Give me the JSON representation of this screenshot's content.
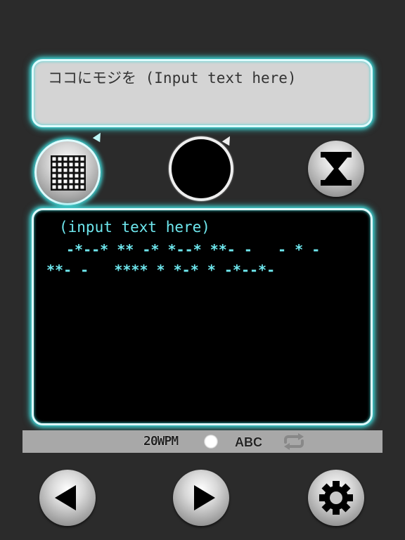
{
  "input": {
    "placeholder": "ココにモジを (Input text here)"
  },
  "output": {
    "plain_text": "(input text here)",
    "morse_line1": "-*--* ** -* *--* **- -   - * -",
    "morse_line2": "**- -   **** * *-* * -*--*-"
  },
  "status": {
    "wpm": "20WPM",
    "mode": "ABC"
  },
  "icons": {
    "grid": "grid-icon",
    "record": "record-icon",
    "timer": "hourglass-icon",
    "repeat": "repeat-icon",
    "prev": "play-backward-icon",
    "play": "play-icon",
    "settings": "gear-icon"
  },
  "colors": {
    "glow": "#3fd6d6",
    "morse_text": "#6ee7ee",
    "background": "#2b2b2b"
  }
}
